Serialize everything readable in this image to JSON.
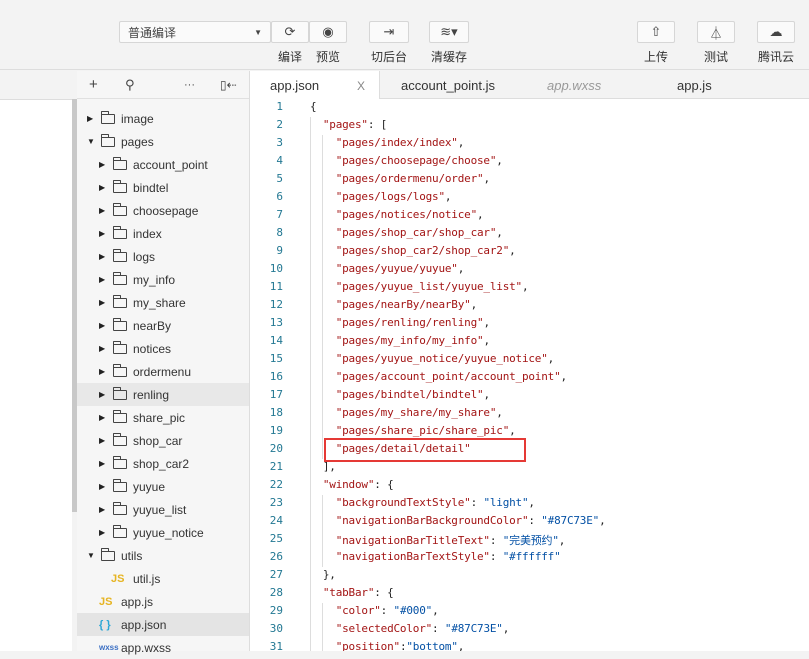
{
  "toolbar": {
    "compile_mode": "普通编译",
    "buttons": [
      {
        "label": "编译",
        "icon": "refresh-icon"
      },
      {
        "label": "预览",
        "icon": "eye-icon"
      },
      {
        "label": "切后台",
        "icon": "switch-background-icon"
      },
      {
        "label": "清缓存",
        "icon": "layers-icon"
      },
      {
        "label": "上传",
        "icon": "upload-icon"
      },
      {
        "label": "测试",
        "icon": "flask-icon"
      },
      {
        "label": "腾讯云",
        "icon": "cloud-icon"
      }
    ]
  },
  "tree": {
    "items": [
      {
        "label": "image",
        "type": "folder",
        "level": 1,
        "open": false
      },
      {
        "label": "pages",
        "type": "folder",
        "level": 1,
        "open": true
      },
      {
        "label": "account_point",
        "type": "folder",
        "level": 2,
        "open": false
      },
      {
        "label": "bindtel",
        "type": "folder",
        "level": 2,
        "open": false
      },
      {
        "label": "choosepage",
        "type": "folder",
        "level": 2,
        "open": false
      },
      {
        "label": "index",
        "type": "folder",
        "level": 2,
        "open": false
      },
      {
        "label": "logs",
        "type": "folder",
        "level": 2,
        "open": false
      },
      {
        "label": "my_info",
        "type": "folder",
        "level": 2,
        "open": false
      },
      {
        "label": "my_share",
        "type": "folder",
        "level": 2,
        "open": false
      },
      {
        "label": "nearBy",
        "type": "folder",
        "level": 2,
        "open": false
      },
      {
        "label": "notices",
        "type": "folder",
        "level": 2,
        "open": false
      },
      {
        "label": "ordermenu",
        "type": "folder",
        "level": 2,
        "open": false
      },
      {
        "label": "renling",
        "type": "folder",
        "level": 2,
        "open": false,
        "hover": true
      },
      {
        "label": "share_pic",
        "type": "folder",
        "level": 2,
        "open": false
      },
      {
        "label": "shop_car",
        "type": "folder",
        "level": 2,
        "open": false
      },
      {
        "label": "shop_car2",
        "type": "folder",
        "level": 2,
        "open": false
      },
      {
        "label": "yuyue",
        "type": "folder",
        "level": 2,
        "open": false
      },
      {
        "label": "yuyue_list",
        "type": "folder",
        "level": 2,
        "open": false
      },
      {
        "label": "yuyue_notice",
        "type": "folder",
        "level": 2,
        "open": false
      },
      {
        "label": "utils",
        "type": "folder",
        "level": 1,
        "open": true
      },
      {
        "label": "util.js",
        "type": "js",
        "level": 2,
        "badge": "JS"
      },
      {
        "label": "app.js",
        "type": "js",
        "level": 1,
        "badge": "JS"
      },
      {
        "label": "app.json",
        "type": "json",
        "level": 1,
        "badge": "{ }",
        "selected": true
      },
      {
        "label": "app.wxss",
        "type": "wxss",
        "level": 1,
        "badge": "wxss"
      }
    ]
  },
  "tabs": [
    {
      "label": "app.json",
      "active": true,
      "close": "X"
    },
    {
      "label": "account_point.js"
    },
    {
      "label": "app.wxss",
      "italic": true
    },
    {
      "label": "app.js"
    }
  ],
  "editor": {
    "lines": [
      [
        [
          "p",
          "{"
        ]
      ],
      [
        [
          "p",
          "  "
        ],
        [
          "k",
          "\"pages\""
        ],
        [
          "p",
          ": ["
        ]
      ],
      [
        [
          "p",
          "    "
        ],
        [
          "k",
          "\"pages/index/index\""
        ],
        [
          "p",
          ","
        ]
      ],
      [
        [
          "p",
          "    "
        ],
        [
          "k",
          "\"pages/choosepage/choose\""
        ],
        [
          "p",
          ","
        ]
      ],
      [
        [
          "p",
          "    "
        ],
        [
          "k",
          "\"pages/ordermenu/order\""
        ],
        [
          "p",
          ","
        ]
      ],
      [
        [
          "p",
          "    "
        ],
        [
          "k",
          "\"pages/logs/logs\""
        ],
        [
          "p",
          ","
        ]
      ],
      [
        [
          "p",
          "    "
        ],
        [
          "k",
          "\"pages/notices/notice\""
        ],
        [
          "p",
          ","
        ]
      ],
      [
        [
          "p",
          "    "
        ],
        [
          "k",
          "\"pages/shop_car/shop_car\""
        ],
        [
          "p",
          ","
        ]
      ],
      [
        [
          "p",
          "    "
        ],
        [
          "k",
          "\"pages/shop_car2/shop_car2\""
        ],
        [
          "p",
          ","
        ]
      ],
      [
        [
          "p",
          "    "
        ],
        [
          "k",
          "\"pages/yuyue/yuyue\""
        ],
        [
          "p",
          ","
        ]
      ],
      [
        [
          "p",
          "    "
        ],
        [
          "k",
          "\"pages/yuyue_list/yuyue_list\""
        ],
        [
          "p",
          ","
        ]
      ],
      [
        [
          "p",
          "    "
        ],
        [
          "k",
          "\"pages/nearBy/nearBy\""
        ],
        [
          "p",
          ","
        ]
      ],
      [
        [
          "p",
          "    "
        ],
        [
          "k",
          "\"pages/renling/renling\""
        ],
        [
          "p",
          ","
        ]
      ],
      [
        [
          "p",
          "    "
        ],
        [
          "k",
          "\"pages/my_info/my_info\""
        ],
        [
          "p",
          ","
        ]
      ],
      [
        [
          "p",
          "    "
        ],
        [
          "k",
          "\"pages/yuyue_notice/yuyue_notice\""
        ],
        [
          "p",
          ","
        ]
      ],
      [
        [
          "p",
          "    "
        ],
        [
          "k",
          "\"pages/account_point/account_point\""
        ],
        [
          "p",
          ","
        ]
      ],
      [
        [
          "p",
          "    "
        ],
        [
          "k",
          "\"pages/bindtel/bindtel\""
        ],
        [
          "p",
          ","
        ]
      ],
      [
        [
          "p",
          "    "
        ],
        [
          "k",
          "\"pages/my_share/my_share\""
        ],
        [
          "p",
          ","
        ]
      ],
      [
        [
          "p",
          "    "
        ],
        [
          "k",
          "\"pages/share_pic/share_pic\""
        ],
        [
          "p",
          ","
        ]
      ],
      [
        [
          "p",
          "    "
        ],
        [
          "k",
          "\"pages/detail/detail\""
        ]
      ],
      [
        [
          "p",
          "  ],"
        ]
      ],
      [
        [
          "p",
          "  "
        ],
        [
          "k",
          "\"window\""
        ],
        [
          "p",
          ": {"
        ]
      ],
      [
        [
          "p",
          "    "
        ],
        [
          "k",
          "\"backgroundTextStyle\""
        ],
        [
          "p",
          ": "
        ],
        [
          "v",
          "\"light\""
        ],
        [
          "p",
          ","
        ]
      ],
      [
        [
          "p",
          "    "
        ],
        [
          "k",
          "\"navigationBarBackgroundColor\""
        ],
        [
          "p",
          ": "
        ],
        [
          "v",
          "\"#87C73E\""
        ],
        [
          "p",
          ","
        ]
      ],
      [
        [
          "p",
          "    "
        ],
        [
          "k",
          "\"navigationBarTitleText\""
        ],
        [
          "p",
          ": "
        ],
        [
          "v",
          "\"完美预约\""
        ],
        [
          "p",
          ","
        ]
      ],
      [
        [
          "p",
          "    "
        ],
        [
          "k",
          "\"navigationBarTextStyle\""
        ],
        [
          "p",
          ": "
        ],
        [
          "v",
          "\"#ffffff\""
        ]
      ],
      [
        [
          "p",
          "  },"
        ]
      ],
      [
        [
          "p",
          "  "
        ],
        [
          "k",
          "\"tabBar\""
        ],
        [
          "p",
          ": {"
        ]
      ],
      [
        [
          "p",
          "    "
        ],
        [
          "k",
          "\"color\""
        ],
        [
          "p",
          ": "
        ],
        [
          "v",
          "\"#000\""
        ],
        [
          "p",
          ","
        ]
      ],
      [
        [
          "p",
          "    "
        ],
        [
          "k",
          "\"selectedColor\""
        ],
        [
          "p",
          ": "
        ],
        [
          "v",
          "\"#87C73E\""
        ],
        [
          "p",
          ","
        ]
      ],
      [
        [
          "p",
          "    "
        ],
        [
          "k",
          "\"position\""
        ],
        [
          "p",
          ":"
        ],
        [
          "v",
          "\"bottom\""
        ],
        [
          "p",
          ","
        ]
      ]
    ]
  },
  "colors": {
    "highlight_box": "#e53935",
    "key": "#a31515",
    "value": "#0451a5",
    "line_number": "#237893"
  }
}
